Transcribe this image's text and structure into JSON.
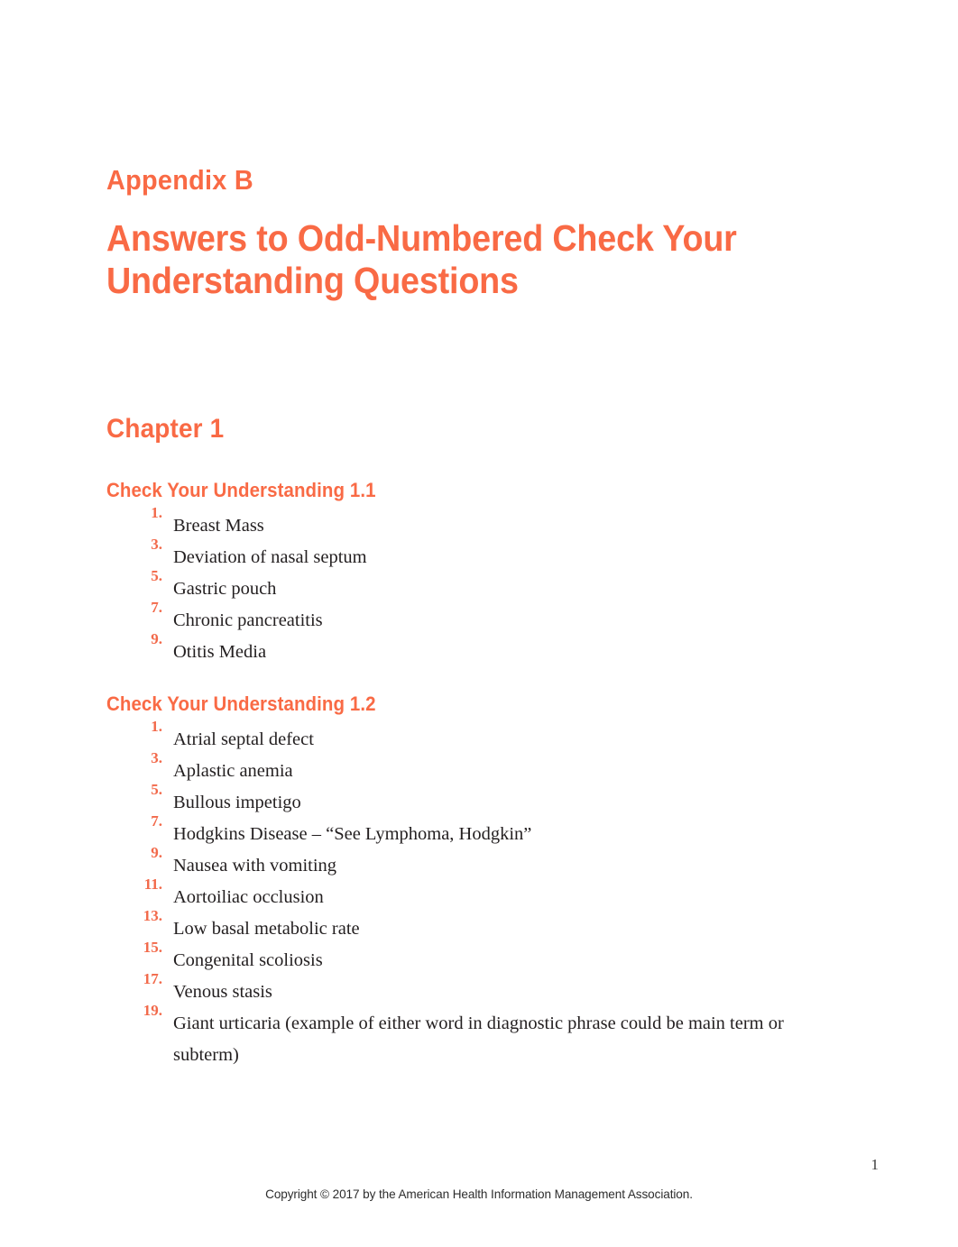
{
  "colors": {
    "accent": "#f96a45",
    "number_accent": "#f2694a",
    "body_text": "#231f20",
    "page_background": "#ffffff",
    "footer_text": "#2d2d2d"
  },
  "header": {
    "appendix_label": "Appendix B",
    "title": "Answers to Odd-Numbered Check Your Understanding Questions"
  },
  "chapter": {
    "heading": "Chapter 1"
  },
  "sections": [
    {
      "heading": "Check Your Understanding 1.1",
      "items": [
        {
          "number": "1.",
          "text": "Breast Mass"
        },
        {
          "number": "3.",
          "text": "Deviation of nasal septum"
        },
        {
          "number": "5.",
          "text": "Gastric pouch"
        },
        {
          "number": "7.",
          "text": "Chronic pancreatitis"
        },
        {
          "number": "9.",
          "text": "Otitis Media"
        }
      ]
    },
    {
      "heading": "Check Your Understanding 1.2",
      "items": [
        {
          "number": "1.",
          "text": "Atrial septal defect"
        },
        {
          "number": "3.",
          "text": "Aplastic anemia"
        },
        {
          "number": "5.",
          "text": "Bullous impetigo"
        },
        {
          "number": "7.",
          "text": "Hodgkins Disease – “See Lymphoma, Hodgkin”"
        },
        {
          "number": "9.",
          "text": "Nausea with vomiting"
        },
        {
          "number": "11.",
          "text": "Aortoiliac occlusion"
        },
        {
          "number": "13.",
          "text": "Low basal metabolic rate"
        },
        {
          "number": "15.",
          "text": "Congenital scoliosis"
        },
        {
          "number": "17.",
          "text": "Venous stasis"
        },
        {
          "number": "19.",
          "text": "Giant urticaria (example of either word in diagnostic phrase could be main term or subterm)"
        }
      ]
    }
  ],
  "footer": {
    "page_number": "1",
    "copyright": "Copyright © 2017 by the American Health Information Management Association."
  }
}
